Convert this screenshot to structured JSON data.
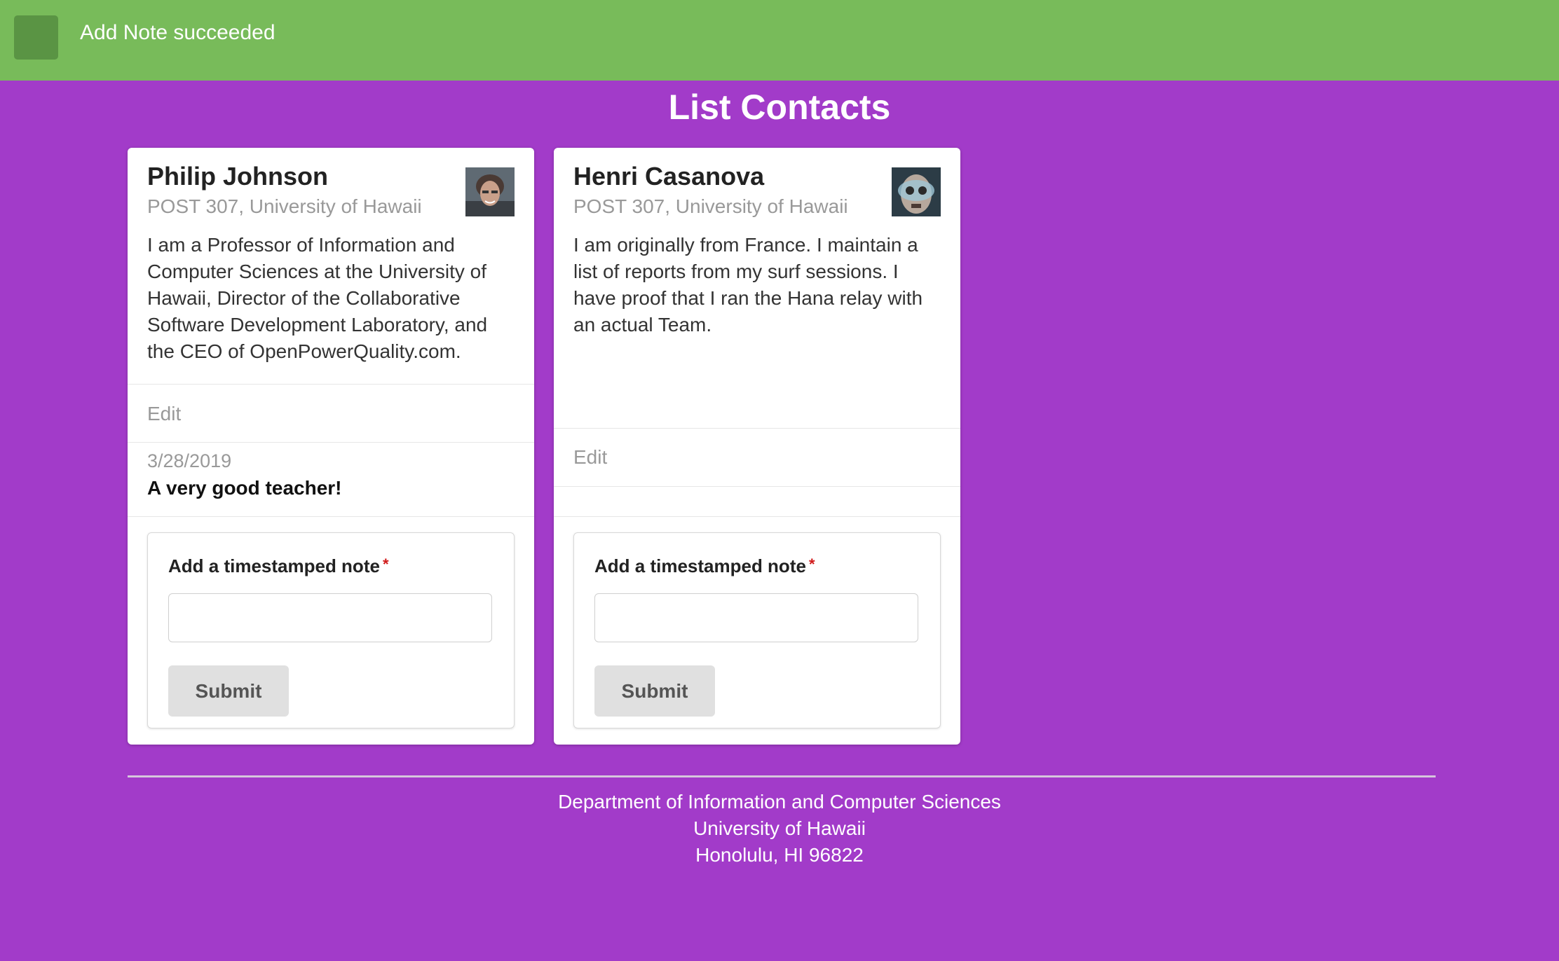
{
  "notification": {
    "message": "Add Note succeeded"
  },
  "page": {
    "title": "List Contacts"
  },
  "contacts": [
    {
      "name": "Philip Johnson",
      "address": "POST 307, University of Hawaii",
      "description": "I am a Professor of Information and Computer Sciences at the University of Hawaii, Director of the Collaborative Software Development Laboratory, and the CEO of OpenPowerQuality.com.",
      "edit_label": "Edit",
      "notes": [
        {
          "date": "3/28/2019",
          "text": "A very good teacher!"
        }
      ],
      "form": {
        "label": "Add a timestamped note",
        "required_mark": "*",
        "value": "",
        "submit_label": "Submit"
      }
    },
    {
      "name": "Henri Casanova",
      "address": "POST 307, University of Hawaii",
      "description": "I am originally from France. I maintain a list of reports from my surf sessions. I have proof that I ran the Hana relay with an actual Team.",
      "edit_label": "Edit",
      "notes": [],
      "form": {
        "label": "Add a timestamped note",
        "required_mark": "*",
        "value": "",
        "submit_label": "Submit"
      }
    }
  ],
  "footer": {
    "line1": "Department of Information and Computer Sciences",
    "line2": "University of Hawaii",
    "line3": "Honolulu, HI 96822"
  },
  "colors": {
    "background": "#a23bc9",
    "notification": "#78bb5a",
    "required": "#d01919"
  }
}
